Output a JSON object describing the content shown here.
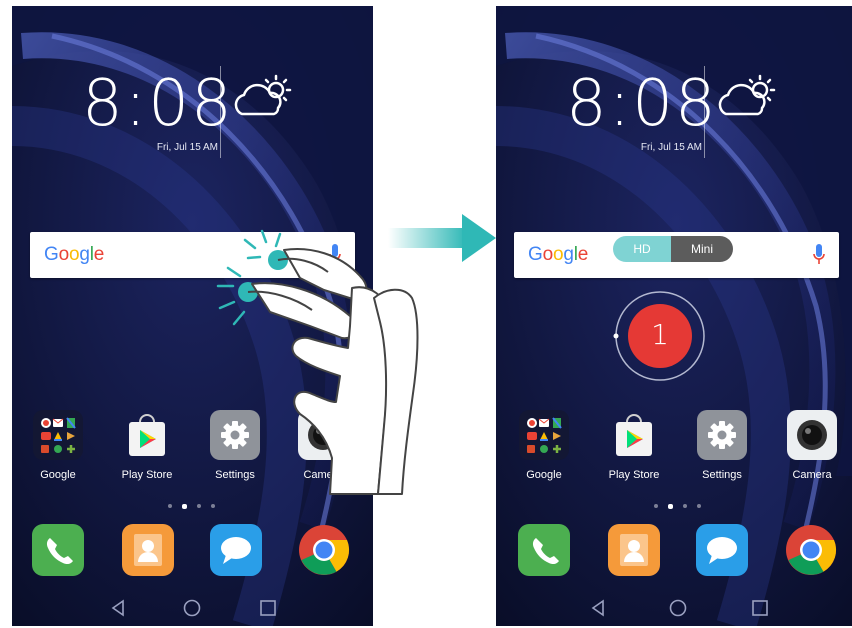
{
  "screens": [
    {
      "id": "before",
      "clock": {
        "time": "8:08",
        "date": "Fri, Jul 15 AM"
      },
      "search": {
        "logo": "Google"
      },
      "apps": [
        {
          "label": "Google",
          "icon": "google-folder-icon"
        },
        {
          "label": "Play Store",
          "icon": "play-store-icon"
        },
        {
          "label": "Settings",
          "icon": "settings-gear-icon"
        },
        {
          "label": "Camera",
          "icon": "camera-icon"
        }
      ],
      "dock": [
        "phone-icon",
        "contacts-icon",
        "messages-icon",
        "chrome-icon"
      ]
    },
    {
      "id": "after",
      "clock": {
        "time": "8:08",
        "date": "Fri, Jul 15 AM"
      },
      "search": {
        "logo": "Google"
      },
      "recording": {
        "mode_hd": "HD",
        "mode_mini": "Mini",
        "countdown": "1"
      },
      "apps": [
        {
          "label": "Google",
          "icon": "google-folder-icon"
        },
        {
          "label": "Play Store",
          "icon": "play-store-icon"
        },
        {
          "label": "Settings",
          "icon": "settings-gear-icon"
        },
        {
          "label": "Camera",
          "icon": "camera-icon"
        }
      ],
      "dock": [
        "phone-icon",
        "contacts-icon",
        "messages-icon",
        "chrome-icon"
      ]
    }
  ],
  "colors": {
    "accent": "#2fb8b6",
    "record_red": "#e53935",
    "wallpaper_dark": "#0b1030",
    "wallpaper_blue": "#3a4fb0",
    "phone_green": "#4caf50",
    "contacts_orange": "#f59a3a",
    "messages_blue": "#2a9ee8",
    "settings_gray": "#8f939a"
  }
}
